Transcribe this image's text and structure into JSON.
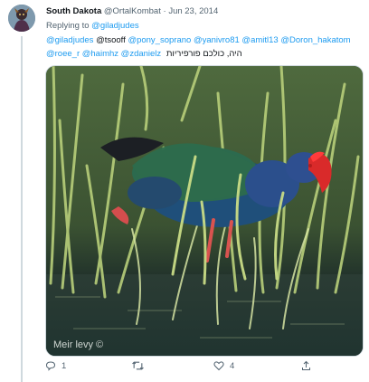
{
  "tweet": {
    "author_name": "South Dakota",
    "handle": "@OrtalKombat",
    "separator": "·",
    "date": "Jun 23, 2014",
    "replying_prefix": "Replying to",
    "replying_to": "@giladjudes",
    "mentions_line1": [
      {
        "text": "@giladjudes",
        "kind": "mention"
      },
      {
        "text": "@tsooff",
        "kind": "plain"
      },
      {
        "text": "@pony_soprano",
        "kind": "mention"
      },
      {
        "text": "@yanivro81",
        "kind": "mention"
      },
      {
        "text": "@amitl13",
        "kind": "mention"
      },
      {
        "text": "@Doron_hakatom",
        "kind": "mention"
      }
    ],
    "mentions_line2": [
      "@roee_r",
      "@haimhz",
      "@zdanielz"
    ],
    "text": "היה, כולכם פורפיריות",
    "media": {
      "alt": "Purple swamphen in reeds",
      "watermark": "Meir levy ©"
    },
    "actions": {
      "reply_count": "1",
      "retweet_count": "",
      "like_count": "4",
      "share_count": ""
    }
  },
  "colors": {
    "accent": "#1d9bf0",
    "secondary_text": "#536471",
    "border": "#cfd9de"
  },
  "icons": [
    "reply-icon",
    "retweet-icon",
    "like-icon",
    "share-icon"
  ]
}
